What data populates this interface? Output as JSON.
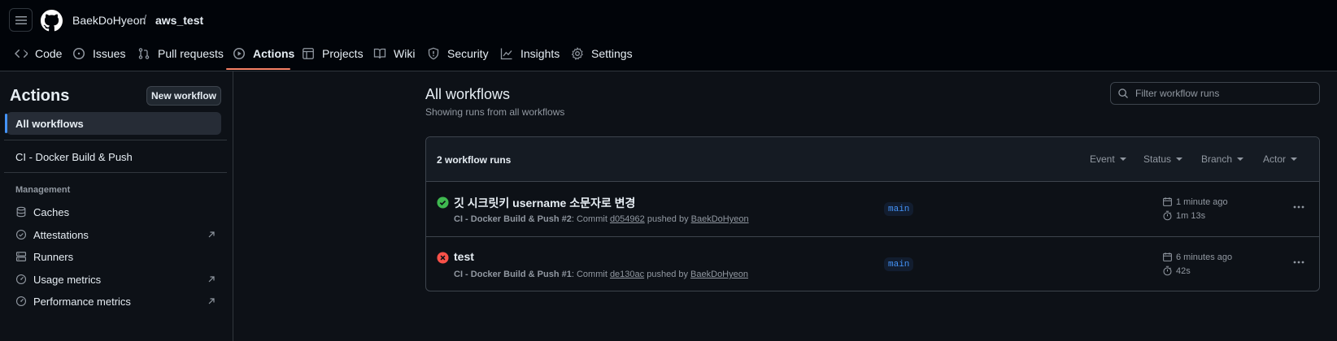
{
  "header": {
    "owner": "BaekDoHyeon",
    "separator": "/",
    "repo": "aws_test",
    "tabs": [
      {
        "label": "Code",
        "icon": "code-icon"
      },
      {
        "label": "Issues",
        "icon": "issue-icon"
      },
      {
        "label": "Pull requests",
        "icon": "pull-request-icon"
      },
      {
        "label": "Actions",
        "icon": "play-icon",
        "active": true
      },
      {
        "label": "Projects",
        "icon": "table-icon"
      },
      {
        "label": "Wiki",
        "icon": "book-icon"
      },
      {
        "label": "Security",
        "icon": "shield-icon"
      },
      {
        "label": "Insights",
        "icon": "graph-icon"
      },
      {
        "label": "Settings",
        "icon": "gear-icon"
      }
    ]
  },
  "sidebar": {
    "title": "Actions",
    "new_workflow": "New workflow",
    "all_workflows": "All workflows",
    "workflows": [
      "CI - Docker Build & Push"
    ],
    "management_label": "Management",
    "management_items": [
      {
        "label": "Caches",
        "icon": "database-icon"
      },
      {
        "label": "Attestations",
        "icon": "verified-icon",
        "external": true
      },
      {
        "label": "Runners",
        "icon": "server-icon"
      },
      {
        "label": "Usage metrics",
        "icon": "meter-icon",
        "external": true
      },
      {
        "label": "Performance metrics",
        "icon": "meter-icon",
        "external": true
      }
    ]
  },
  "main": {
    "title": "All workflows",
    "subtitle": "Showing runs from all workflows",
    "filter_placeholder": "Filter workflow runs",
    "runs_count": "2 workflow runs",
    "filters": [
      "Event",
      "Status",
      "Branch",
      "Actor"
    ],
    "runs": [
      {
        "status": "success",
        "title": "깃 시크릿키 username 소문자로 변경",
        "workflow": "CI - Docker Build & Push #2",
        "commit_prefix": ": Commit",
        "commit": "d054962",
        "pushed_by": "pushed by",
        "actor": "BaekDoHyeon",
        "branch": "main",
        "time": "1 minute ago",
        "duration": "1m 13s"
      },
      {
        "status": "failure",
        "title": "test",
        "workflow": "CI - Docker Build & Push #1",
        "commit_prefix": ": Commit",
        "commit": "de130ac",
        "pushed_by": "pushed by",
        "actor": "BaekDoHyeon",
        "branch": "main",
        "time": "6 minutes ago",
        "duration": "42s"
      }
    ]
  },
  "colors": {
    "success": "#3fb950",
    "failure": "#f85149",
    "accent": "#4493f8",
    "active_tab_underline": "#f78166"
  }
}
